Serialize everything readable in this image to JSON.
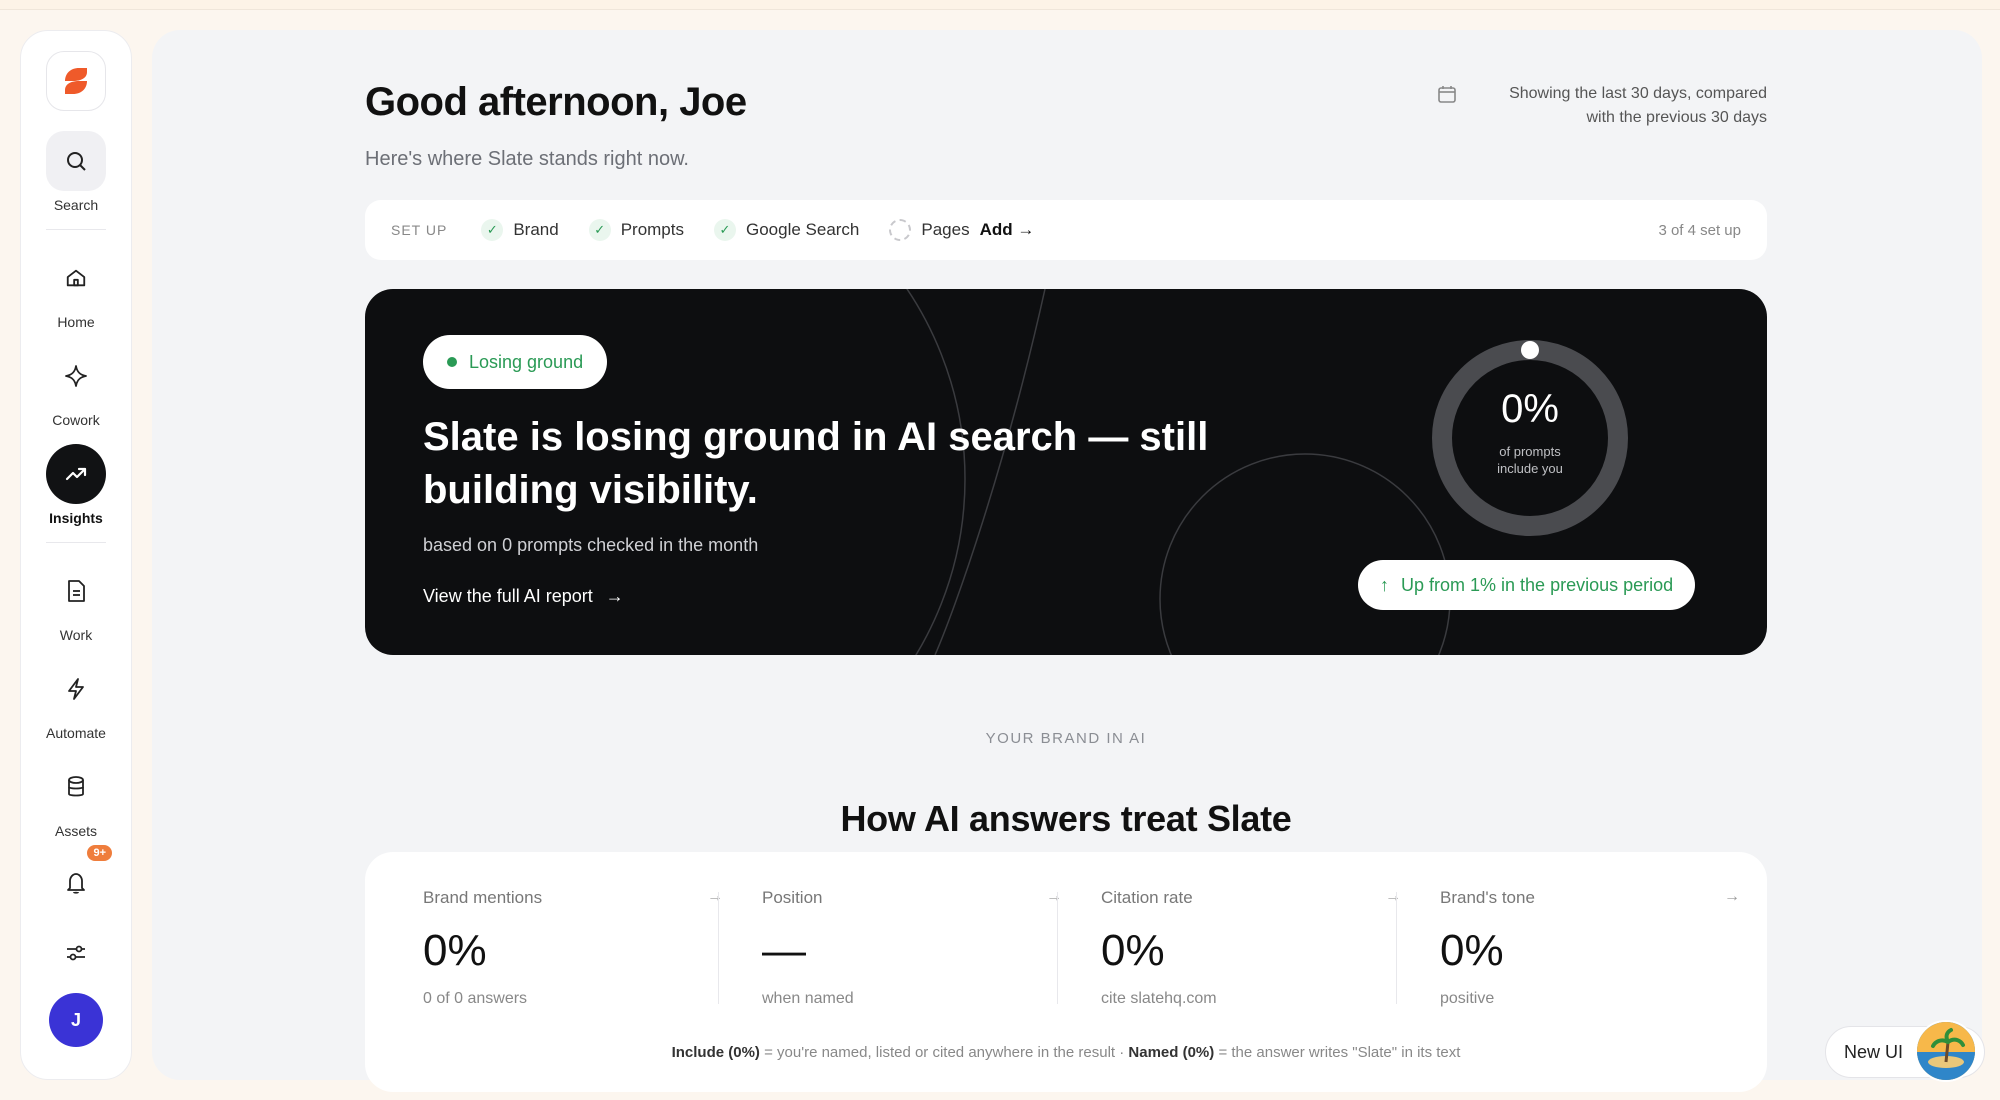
{
  "sidebar": {
    "items": [
      {
        "label": "Search",
        "icon": "search-icon"
      },
      {
        "label": "Home",
        "icon": "home-icon"
      },
      {
        "label": "Cowork",
        "icon": "sparkle-icon"
      },
      {
        "label": "Insights",
        "icon": "trending-up-icon",
        "active": true
      },
      {
        "label": "Work",
        "icon": "document-icon"
      },
      {
        "label": "Automate",
        "icon": "bolt-icon"
      },
      {
        "label": "Assets",
        "icon": "database-icon"
      }
    ],
    "notifications_badge": "9+",
    "avatar_initial": "J"
  },
  "header": {
    "greeting": "Good afternoon, Joe",
    "subtitle": "Here's where Slate stands right now.",
    "period_line1": "Showing the last 30 days, compared",
    "period_line2": "with the previous 30 days"
  },
  "setup": {
    "title": "SET UP",
    "steps": [
      {
        "label": "Brand",
        "done": true
      },
      {
        "label": "Prompts",
        "done": true
      },
      {
        "label": "Google Search",
        "done": true
      },
      {
        "label": "Pages",
        "done": false
      }
    ],
    "add_label": "Add →",
    "count": "3 of 4 set up"
  },
  "hero": {
    "status": "Losing ground",
    "title": "Slate is losing ground in AI search — still building visibility.",
    "subtitle": "based on 0 prompts checked in the month",
    "link": "View the full AI report",
    "ring_value": "0%",
    "ring_value_fraction": 0,
    "ring_caption_line1": "of prompts",
    "ring_caption_line2": "include you",
    "change": "Up from 1% in the previous period"
  },
  "brand_section": {
    "eyebrow": "YOUR BRAND IN AI",
    "title": "How AI answers treat Slate",
    "metrics": [
      {
        "label": "Brand mentions",
        "value": "0%",
        "sub": "0 of 0 answers"
      },
      {
        "label": "Position",
        "value": "—",
        "sub": "when named"
      },
      {
        "label": "Citation rate",
        "value": "0%",
        "sub": "cite slatehq.com"
      },
      {
        "label": "Brand's tone",
        "value": "0%",
        "sub": "positive"
      }
    ],
    "footnote": {
      "include_term": "Include (0%)",
      "include_def": "= you're named, listed or cited anywhere in the result ·",
      "named_term": "Named (0%)",
      "named_def": "= the answer writes \"Slate\" in its text"
    }
  },
  "new_ui_label": "New UI",
  "colors": {
    "accent_green": "#2a9a55",
    "brand_orange": "#ef5a2a",
    "avatar_blue": "#3a33d6",
    "hero_bg": "#0d0e10"
  }
}
